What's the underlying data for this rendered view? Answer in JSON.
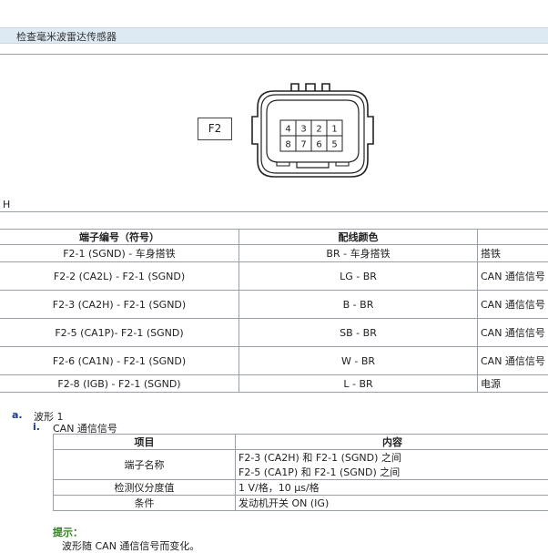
{
  "section": {
    "title": "检查毫米波雷达传感器"
  },
  "connector": {
    "label": "F2",
    "pins_top": [
      "4",
      "3",
      "2",
      "1"
    ],
    "pins_bottom": [
      "8",
      "7",
      "6",
      "5"
    ]
  },
  "view_label": "H",
  "terminal_table": {
    "headers": [
      "端子编号（符号）",
      "配线颜色",
      ""
    ],
    "rows": [
      {
        "terminal": "F2-1 (SGND) - 车身搭铁",
        "wire": "BR - 车身搭铁",
        "desc": "搭铁"
      },
      {
        "terminal": "F2-2 (CA2L) - F2-1 (SGND)",
        "wire": "LG - BR",
        "desc": "CAN 通信信号"
      },
      {
        "terminal": "F2-3 (CA2H) - F2-1 (SGND)",
        "wire": "B - BR",
        "desc": "CAN 通信信号"
      },
      {
        "terminal": "F2-5 (CA1P)- F2-1 (SGND)",
        "wire": "SB - BR",
        "desc": "CAN 通信信号"
      },
      {
        "terminal": "F2-6 (CA1N) - F2-1 (SGND)",
        "wire": "W - BR",
        "desc": "CAN 通信信号"
      },
      {
        "terminal": "F2-8 (IGB) - F2-1 (SGND)",
        "wire": "L - BR",
        "desc": "电源"
      }
    ]
  },
  "list": {
    "a_num": "a.",
    "a_text": "波形 1",
    "i_num": "i.",
    "i_text": "CAN 通信信号"
  },
  "waveform_table": {
    "headers": [
      "项目",
      "内容"
    ],
    "rows": [
      {
        "item": "端子名称",
        "content": [
          "F2-3 (CA2H) 和 F2-1 (SGND) 之间",
          "F2-5 (CA1P) 和 F2-1 (SGND) 之间"
        ]
      },
      {
        "item": "检测仪分度值",
        "content": [
          "1 V/格，10 μs/格"
        ]
      },
      {
        "item": "条件",
        "content": [
          "发动机开关 ON (IG)"
        ]
      }
    ]
  },
  "hint": {
    "title": "提示：",
    "text": "波形随 CAN 通信信号而变化。"
  }
}
